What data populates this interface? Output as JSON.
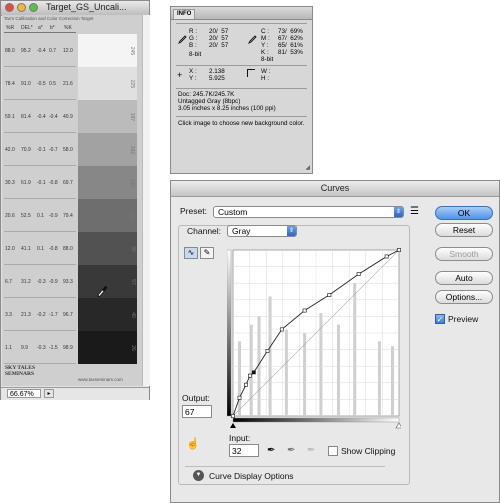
{
  "document_window": {
    "title": "Target_GS_Uncali...",
    "heading": "Tax's Calibration and Color Correction Target",
    "columns": [
      "%R",
      "DEL*",
      "a*",
      "b*",
      "%K"
    ],
    "rows": [
      [
        "88.0",
        "95.2",
        "-0.4",
        "0.7",
        "12.0"
      ],
      [
        "78.4",
        "91.0",
        "-0.5",
        "0.5",
        "21.6"
      ],
      [
        "59.1",
        "81.4",
        "-0.4",
        "-0.4",
        "40.9"
      ],
      [
        "42.0",
        "70.9",
        "-0.1",
        "-0.7",
        "58.0"
      ],
      [
        "30.3",
        "61.9",
        "-0.1",
        "-0.8",
        "69.7"
      ],
      [
        "20.6",
        "52.5",
        "0.1",
        "-0.9",
        "79.4"
      ],
      [
        "12.0",
        "41.1",
        "0.1",
        "-0.8",
        "88.0"
      ],
      [
        "6.7",
        "31.2",
        "-0.3",
        "-0.9",
        "93.3"
      ],
      [
        "3.3",
        "21.3",
        "-0.2",
        "-1.7",
        "96.7"
      ],
      [
        "1.1",
        "9.9",
        "-0.3",
        "-1.5",
        "98.9"
      ]
    ],
    "patches": [
      {
        "label": "245",
        "color": "#f4f4f4"
      },
      {
        "label": "225",
        "color": "#e0e0e0"
      },
      {
        "label": "187",
        "color": "#bbbbbb"
      },
      {
        "label": "162",
        "color": "#a2a2a2"
      },
      {
        "label": "135",
        "color": "#878787"
      },
      {
        "label": "110",
        "color": "#6e6e6e"
      },
      {
        "label": "82",
        "color": "#525252"
      },
      {
        "label": "57",
        "color": "#393939"
      },
      {
        "label": "40",
        "color": "#282828"
      },
      {
        "label": "26",
        "color": "#1a1a1a"
      }
    ],
    "logo": "SKY TALES SEMINARS",
    "url": "www.taxseminars.com",
    "zoom": "66.67%"
  },
  "info_panel": {
    "tab": "INFO",
    "rgb": {
      "R": "20/  57",
      "G": "20/  57",
      "B": "20/  57",
      "bit": "8-bit"
    },
    "cmyk": {
      "C": "73/  69%",
      "M": "67/  62%",
      "Y": "65/  61%",
      "K": "81/  53%",
      "bit": "8-bit"
    },
    "xy": {
      "X": "2.138",
      "Y": "5.925"
    },
    "wh": {
      "W": "",
      "H": ""
    },
    "doc": "Doc: 245.7K/245.7K",
    "profile": "Untagged Gray (8bpc)",
    "dims": "3.05 inches x 8.25 inches (100 ppi)",
    "hint": "Click image to choose new background color."
  },
  "curves_dialog": {
    "title": "Curves",
    "preset_label": "Preset:",
    "preset_value": "Custom",
    "channel_label": "Channel:",
    "channel_value": "Gray",
    "output_label": "Output:",
    "output_value": "67",
    "input_label": "Input:",
    "input_value": "32",
    "show_clipping_label": "Show Clipping",
    "show_clipping_checked": false,
    "display_options_label": "Curve Display Options",
    "buttons": {
      "ok": "OK",
      "reset": "Reset",
      "smooth": "Smooth",
      "auto": "Auto",
      "options": "Options..."
    },
    "preview_label": "Preview",
    "preview_checked": true,
    "curve_points": [
      [
        0,
        0
      ],
      [
        10,
        28
      ],
      [
        20,
        48
      ],
      [
        26,
        62
      ],
      [
        32,
        67
      ],
      [
        53,
        100
      ],
      [
        75,
        133
      ],
      [
        110,
        162
      ],
      [
        148,
        186
      ],
      [
        193,
        218
      ],
      [
        236,
        245
      ],
      [
        255,
        255
      ]
    ]
  },
  "colors": {
    "accent_blue": "#4f94e8",
    "curve": "#222222",
    "histogram": "#cfcfcf"
  }
}
